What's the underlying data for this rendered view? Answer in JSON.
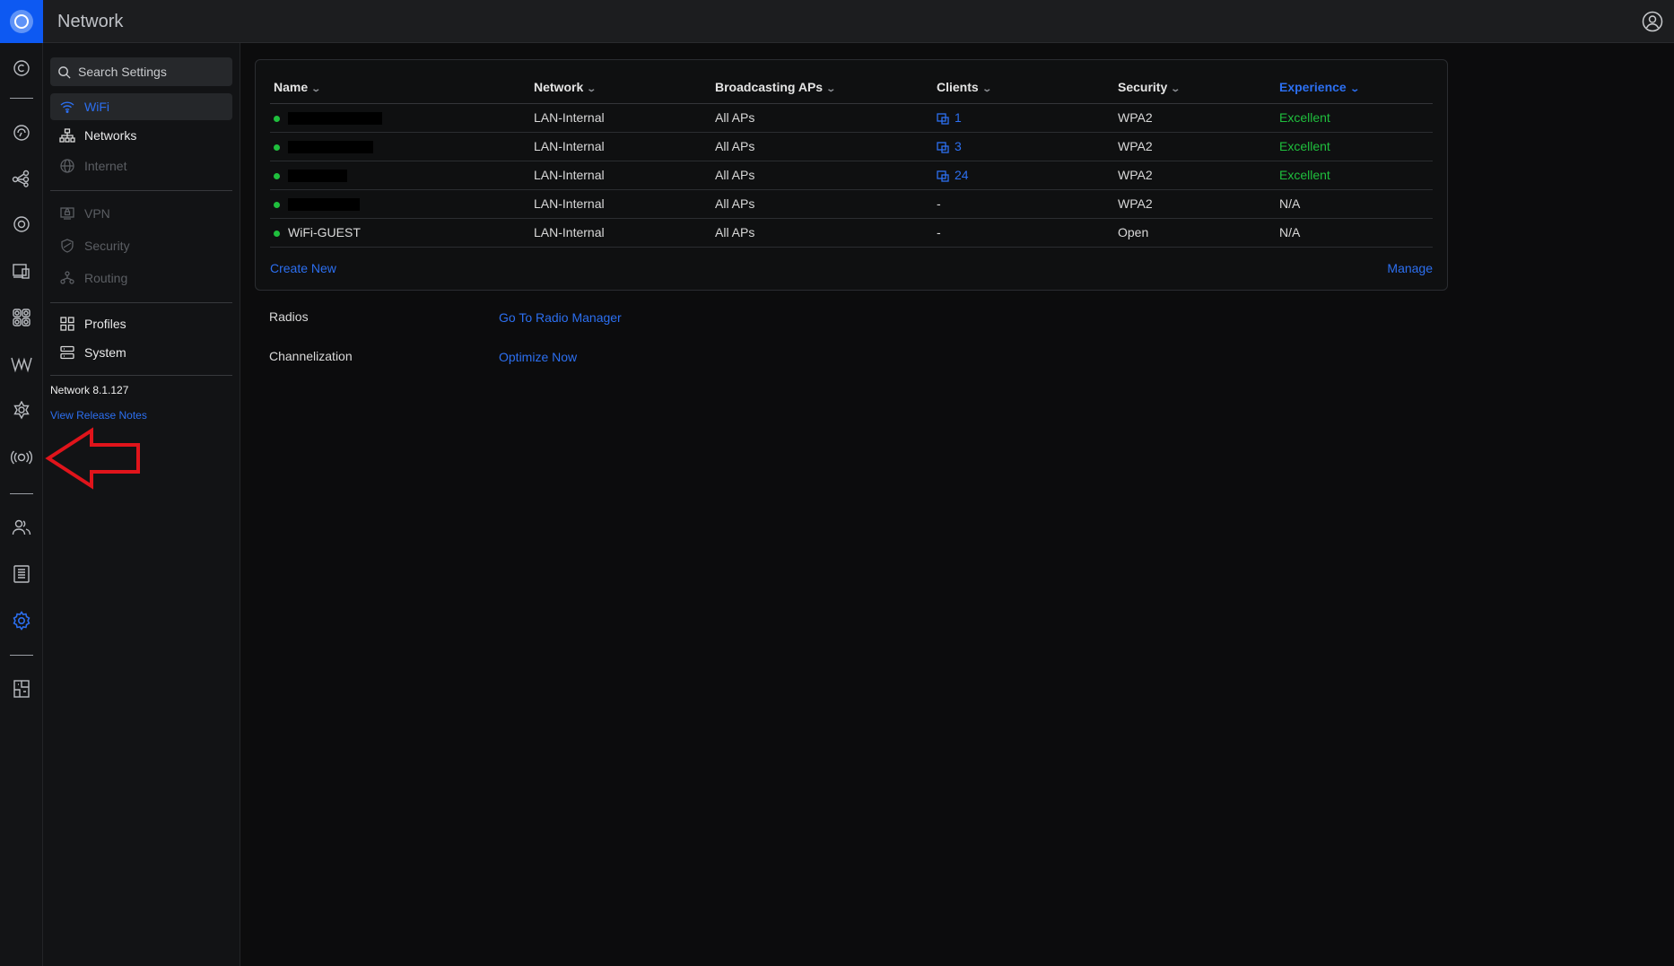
{
  "app": {
    "title": "Network"
  },
  "sidebar": {
    "search_placeholder": "Search Settings",
    "items": [
      {
        "label": "WiFi",
        "state": "active",
        "icon": "wifi-icon"
      },
      {
        "label": "Networks",
        "state": "normal",
        "icon": "network-tree-icon"
      },
      {
        "label": "Internet",
        "state": "disabled",
        "icon": "globe-icon"
      },
      {
        "label": "VPN",
        "state": "disabled",
        "icon": "vpn-icon"
      },
      {
        "label": "Security",
        "state": "disabled",
        "icon": "shield-icon"
      },
      {
        "label": "Routing",
        "state": "disabled",
        "icon": "routing-icon"
      },
      {
        "label": "Profiles",
        "state": "normal",
        "icon": "profiles-icon"
      },
      {
        "label": "System",
        "state": "normal",
        "icon": "system-icon"
      }
    ],
    "version": "Network 8.1.127",
    "release_notes": "View Release Notes"
  },
  "wifi_table": {
    "headers": [
      "Name",
      "Network",
      "Broadcasting APs",
      "Clients",
      "Security",
      "Experience"
    ],
    "rows": [
      {
        "name": "",
        "network": "LAN-Internal",
        "aps": "All APs",
        "clients": "1",
        "security": "WPA2",
        "experience": "Excellent"
      },
      {
        "name": "",
        "network": "LAN-Internal",
        "aps": "All APs",
        "clients": "3",
        "security": "WPA2",
        "experience": "Excellent"
      },
      {
        "name": "",
        "network": "LAN-Internal",
        "aps": "All APs",
        "clients": "24",
        "security": "WPA2",
        "experience": "Excellent"
      },
      {
        "name": "",
        "network": "LAN-Internal",
        "aps": "All APs",
        "clients": "-",
        "security": "WPA2",
        "experience": "N/A"
      },
      {
        "name": "WiFi-GUEST",
        "network": "LAN-Internal",
        "aps": "All APs",
        "clients": "-",
        "security": "Open",
        "experience": "N/A"
      }
    ],
    "create_new": "Create New",
    "manage": "Manage"
  },
  "radios": {
    "label": "Radios",
    "link": "Go To Radio Manager"
  },
  "channelization": {
    "label": "Channelization",
    "link": "Optimize Now"
  },
  "colors": {
    "accent": "#2c6ff0",
    "success": "#1fbf3d",
    "annotation": "#e0141b"
  }
}
